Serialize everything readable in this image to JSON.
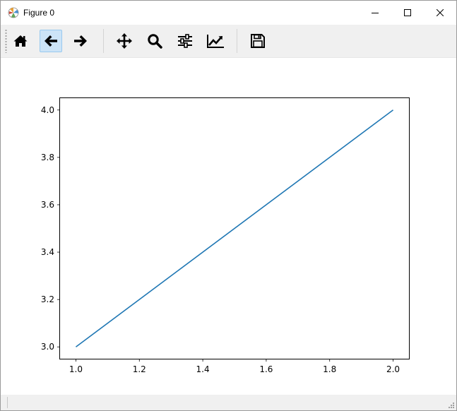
{
  "window": {
    "title": "Figure 0",
    "controls": [
      "minimize",
      "maximize",
      "close"
    ]
  },
  "toolbar": {
    "buttons": [
      {
        "name": "home",
        "icon": "home-icon",
        "active": false
      },
      {
        "name": "back",
        "icon": "arrow-left-icon",
        "active": true
      },
      {
        "name": "forward",
        "icon": "arrow-right-icon",
        "active": false
      },
      {
        "name": "pan",
        "icon": "move-icon",
        "active": false
      },
      {
        "name": "zoom",
        "icon": "magnifier-icon",
        "active": false
      },
      {
        "name": "subplots",
        "icon": "sliders-icon",
        "active": false
      },
      {
        "name": "customize",
        "icon": "line-chart-icon",
        "active": false
      },
      {
        "name": "save",
        "icon": "floppy-disk-icon",
        "active": false
      }
    ]
  },
  "status": {
    "text": ""
  },
  "colors": {
    "line": "#1f77b4",
    "toolbar_bg": "#f0f0f0",
    "active_button_bg": "#cce4f7"
  },
  "chart_data": {
    "type": "line",
    "title": "",
    "xlabel": "",
    "ylabel": "",
    "series": [
      {
        "x": [
          1.0,
          2.0
        ],
        "y": [
          3.0,
          4.0
        ]
      }
    ],
    "xlim": [
      0.95,
      2.05
    ],
    "ylim": [
      2.95,
      4.05
    ],
    "xticks": [
      1.0,
      1.2,
      1.4,
      1.6,
      1.8,
      2.0
    ],
    "xtick_labels": [
      "1.0",
      "1.2",
      "1.4",
      "1.6",
      "1.8",
      "2.0"
    ],
    "yticks": [
      3.0,
      3.2,
      3.4,
      3.6,
      3.8,
      4.0
    ],
    "ytick_labels": [
      "3.0",
      "3.2",
      "3.4",
      "3.6",
      "3.8",
      "4.0"
    ],
    "grid": false,
    "legend": "none"
  }
}
